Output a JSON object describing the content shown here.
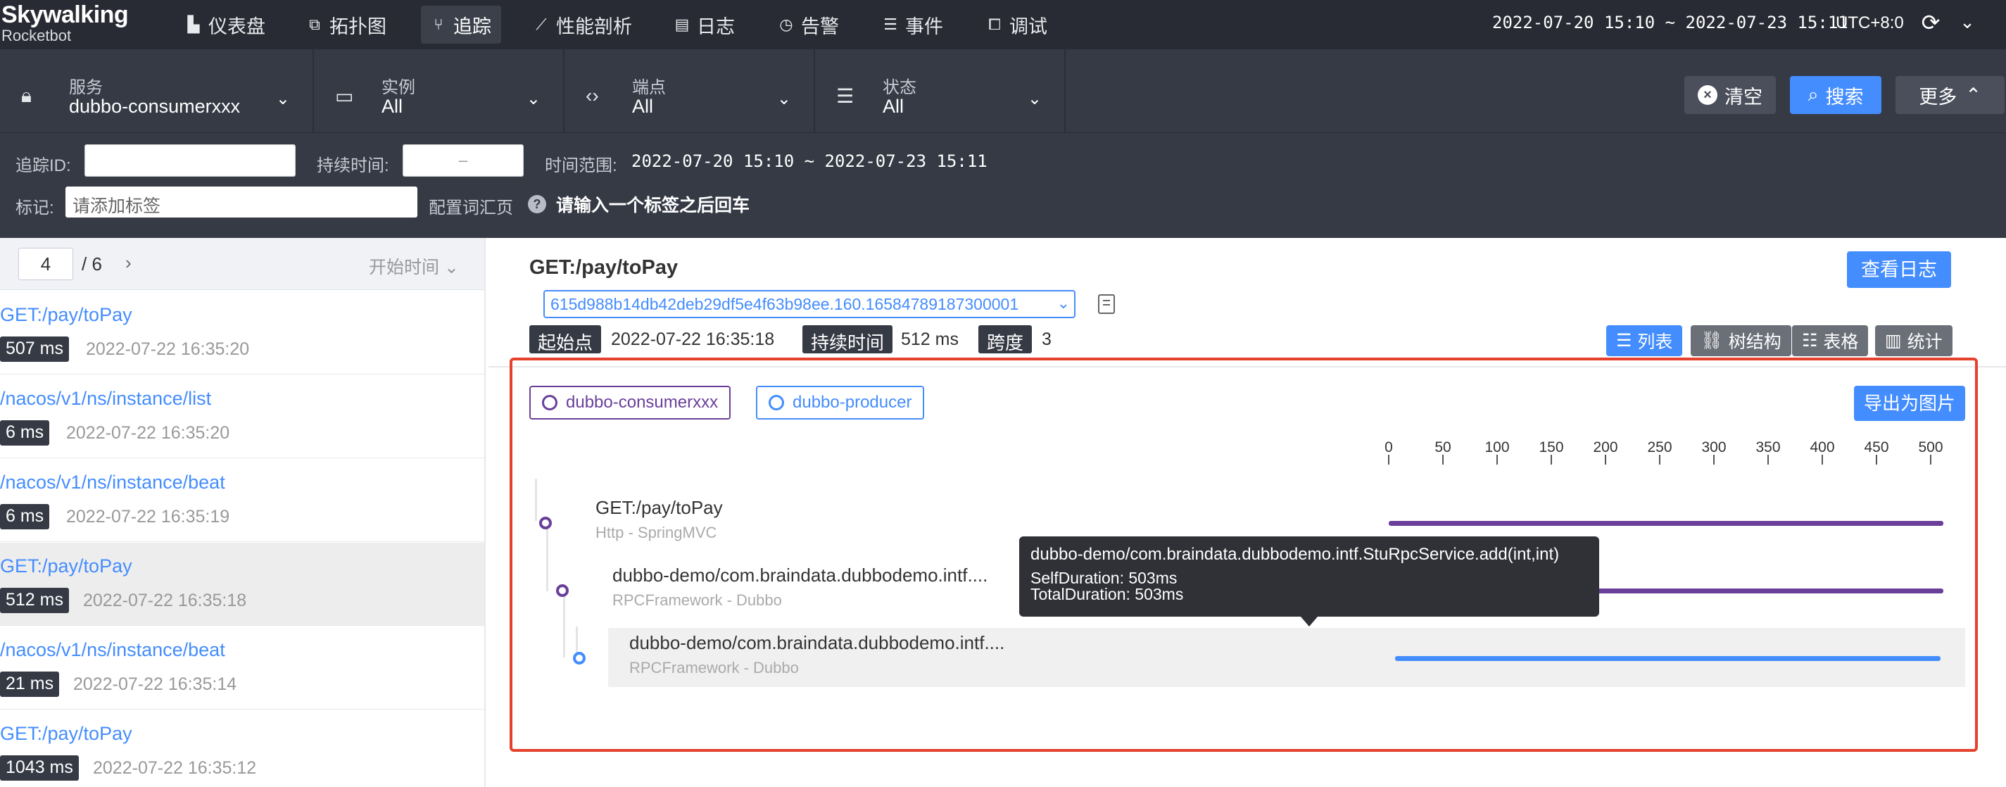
{
  "app": {
    "logo_line1": "Skywalking",
    "logo_line2": "Rocketbot"
  },
  "nav": {
    "items": [
      {
        "label": "仪表盘",
        "icon": "dashboard-icon",
        "glyph": "▙"
      },
      {
        "label": "拓扑图",
        "icon": "topology-icon",
        "glyph": "⧉"
      },
      {
        "label": "追踪",
        "icon": "trace-icon",
        "glyph": "⑂",
        "active": true
      },
      {
        "label": "性能剖析",
        "icon": "profile-icon",
        "glyph": "⟋"
      },
      {
        "label": "日志",
        "icon": "log-icon",
        "glyph": "▤"
      },
      {
        "label": "告警",
        "icon": "alarm-icon",
        "glyph": "◷"
      },
      {
        "label": "事件",
        "icon": "event-icon",
        "glyph": "☰"
      },
      {
        "label": "调试",
        "icon": "debug-icon",
        "glyph": "⧠"
      }
    ],
    "time_range": "2022-07-20 15:10 ~ 2022-07-23 15:11",
    "timezone": "UTC+8:0"
  },
  "filters": {
    "service": {
      "label": "服务",
      "value": "dubbo-consumerxxx"
    },
    "instance": {
      "label": "实例",
      "value": "All"
    },
    "endpoint": {
      "label": "端点",
      "value": "All"
    },
    "status": {
      "label": "状态",
      "value": "All"
    },
    "clear_label": "清空",
    "search_label": "搜索",
    "more_label": "更多"
  },
  "advanced": {
    "trace_id_label": "追踪ID:",
    "trace_id_value": "",
    "duration_label": "持续时间:",
    "duration_placeholder": "–",
    "time_range_label": "时间范围:",
    "time_range_value": "2022-07-20 15:10 ~ 2022-07-23 15:11",
    "tags_label": "标记:",
    "tags_placeholder": "请添加标签",
    "vocab_label": "配置词汇页",
    "hint": "请输入一个标签之后回车"
  },
  "list": {
    "page": "4",
    "total": "/ 6",
    "sort_label": "开始时间",
    "traces": [
      {
        "name": "GET:/pay/toPay",
        "duration": "507 ms",
        "time": "2022-07-22 16:35:20"
      },
      {
        "name": "/nacos/v1/ns/instance/list",
        "duration": "6 ms",
        "time": "2022-07-22 16:35:20"
      },
      {
        "name": "/nacos/v1/ns/instance/beat",
        "duration": "6 ms",
        "time": "2022-07-22 16:35:19"
      },
      {
        "name": "GET:/pay/toPay",
        "duration": "512 ms",
        "time": "2022-07-22 16:35:18",
        "selected": true
      },
      {
        "name": "/nacos/v1/ns/instance/beat",
        "duration": "21 ms",
        "time": "2022-07-22 16:35:14"
      },
      {
        "name": "GET:/pay/toPay",
        "duration": "1043 ms",
        "time": "2022-07-22 16:35:12"
      }
    ]
  },
  "detail": {
    "title": "GET:/pay/toPay",
    "view_log_label": "查看日志",
    "trace_id": "615d988b14db42deb29df5e4f63b98ee.160.16584789187300001",
    "start_label": "起始点",
    "start_value": "2022-07-22 16:35:18",
    "duration_label": "持续时间",
    "duration_value": "512 ms",
    "span_label": "跨度",
    "span_value": "3",
    "views": [
      {
        "label": "列表",
        "icon": "list-icon",
        "glyph": "☰",
        "active": true
      },
      {
        "label": "树结构",
        "icon": "tree-icon",
        "glyph": "⛓"
      },
      {
        "label": "表格",
        "icon": "table-icon",
        "glyph": "☷"
      },
      {
        "label": "统计",
        "icon": "stats-icon",
        "glyph": "▥"
      }
    ]
  },
  "trace_view": {
    "services": [
      {
        "name": "dubbo-consumerxxx",
        "color": "#6a3f9a"
      },
      {
        "name": "dubbo-producer",
        "color": "#448dfe"
      }
    ],
    "export_label": "导出为图片",
    "axis_ticks": [
      "0",
      "50",
      "100",
      "150",
      "200",
      "250",
      "300",
      "350",
      "400",
      "450",
      "500"
    ],
    "axis_max": 512,
    "spans": [
      {
        "name": "GET:/pay/toPay",
        "sub": "Http - SpringMVC",
        "start": 0,
        "end": 512,
        "color": "#6a3f9a"
      },
      {
        "name": "dubbo-demo/com.braindata.dubbodemo.intf....",
        "sub": "RPCFramework - Dubbo",
        "start": 4,
        "end": 512,
        "color": "#6a3f9a"
      },
      {
        "name": "dubbo-demo/com.braindata.dubbodemo.intf....",
        "sub": "RPCFramework - Dubbo",
        "start": 6,
        "end": 509,
        "color": "#448dfe"
      }
    ],
    "tooltip": {
      "title": "dubbo-demo/com.braindata.dubbodemo.intf.StuRpcService.add(int,int)",
      "self_duration": "SelfDuration: 503ms",
      "total_duration": "TotalDuration: 503ms"
    }
  }
}
